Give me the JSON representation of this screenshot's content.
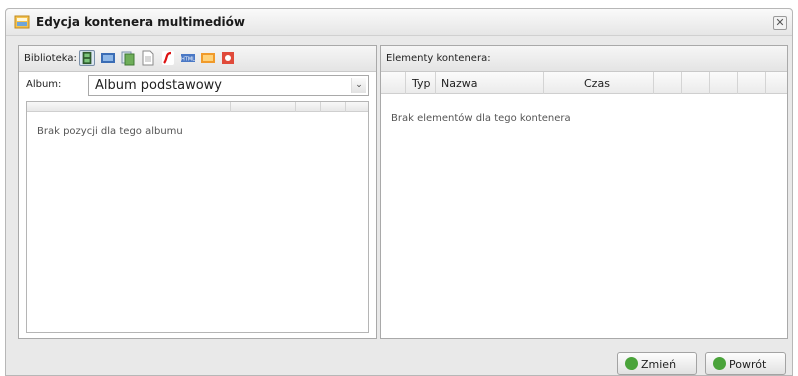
{
  "dialog": {
    "title": "Edycja kontenera multimediów"
  },
  "library": {
    "label": "Biblioteka:",
    "icons": [
      {
        "name": "film-icon",
        "active": true
      },
      {
        "name": "image-icon"
      },
      {
        "name": "copy-icon"
      },
      {
        "name": "document-icon"
      },
      {
        "name": "flash-icon"
      },
      {
        "name": "html-icon"
      },
      {
        "name": "rss-icon"
      },
      {
        "name": "stop-icon"
      }
    ]
  },
  "album": {
    "label": "Album:",
    "selected": "Album podstawowy",
    "empty_text": "Brak pozycji dla tego albumu"
  },
  "container": {
    "title": "Elementy kontenera:",
    "columns": [
      "Typ",
      "Nazwa",
      "Czas"
    ],
    "empty_text": "Brak elementów dla tego kontenera"
  },
  "buttons": {
    "change": "Zmień",
    "back": "Powrót"
  },
  "colors": {
    "accent_green": "#4aa33a",
    "panel_bg": "#e9e9e9"
  }
}
